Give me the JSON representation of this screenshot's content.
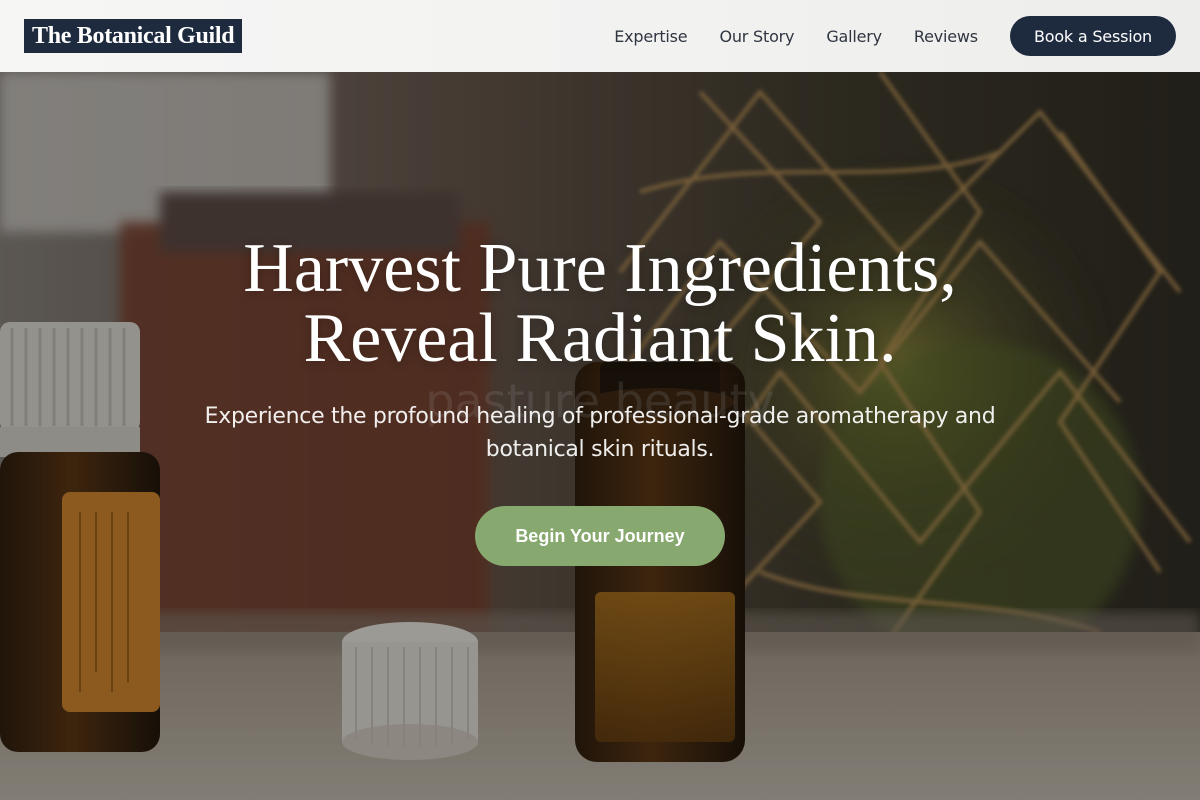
{
  "header": {
    "logo_text": "The Botanical Guild",
    "nav": [
      {
        "label": "Expertise"
      },
      {
        "label": "Our Story"
      },
      {
        "label": "Gallery"
      },
      {
        "label": "Reviews"
      }
    ],
    "cta_label": "Book a Session"
  },
  "hero": {
    "title_line1": "Harvest Pure Ingredients,",
    "title_line2": "Reveal Radiant Skin.",
    "subtitle": "Experience the profound healing of professional-grade aromatherapy and botanical skin rituals.",
    "button_label": "Begin Your Journey",
    "watermark_text": "pasture beauty",
    "background_description_icon": "essential-oil-photo"
  },
  "colors": {
    "navy": "#1e2a3e",
    "sage": "#87a86f",
    "header_bg": "#f4f4f3"
  }
}
